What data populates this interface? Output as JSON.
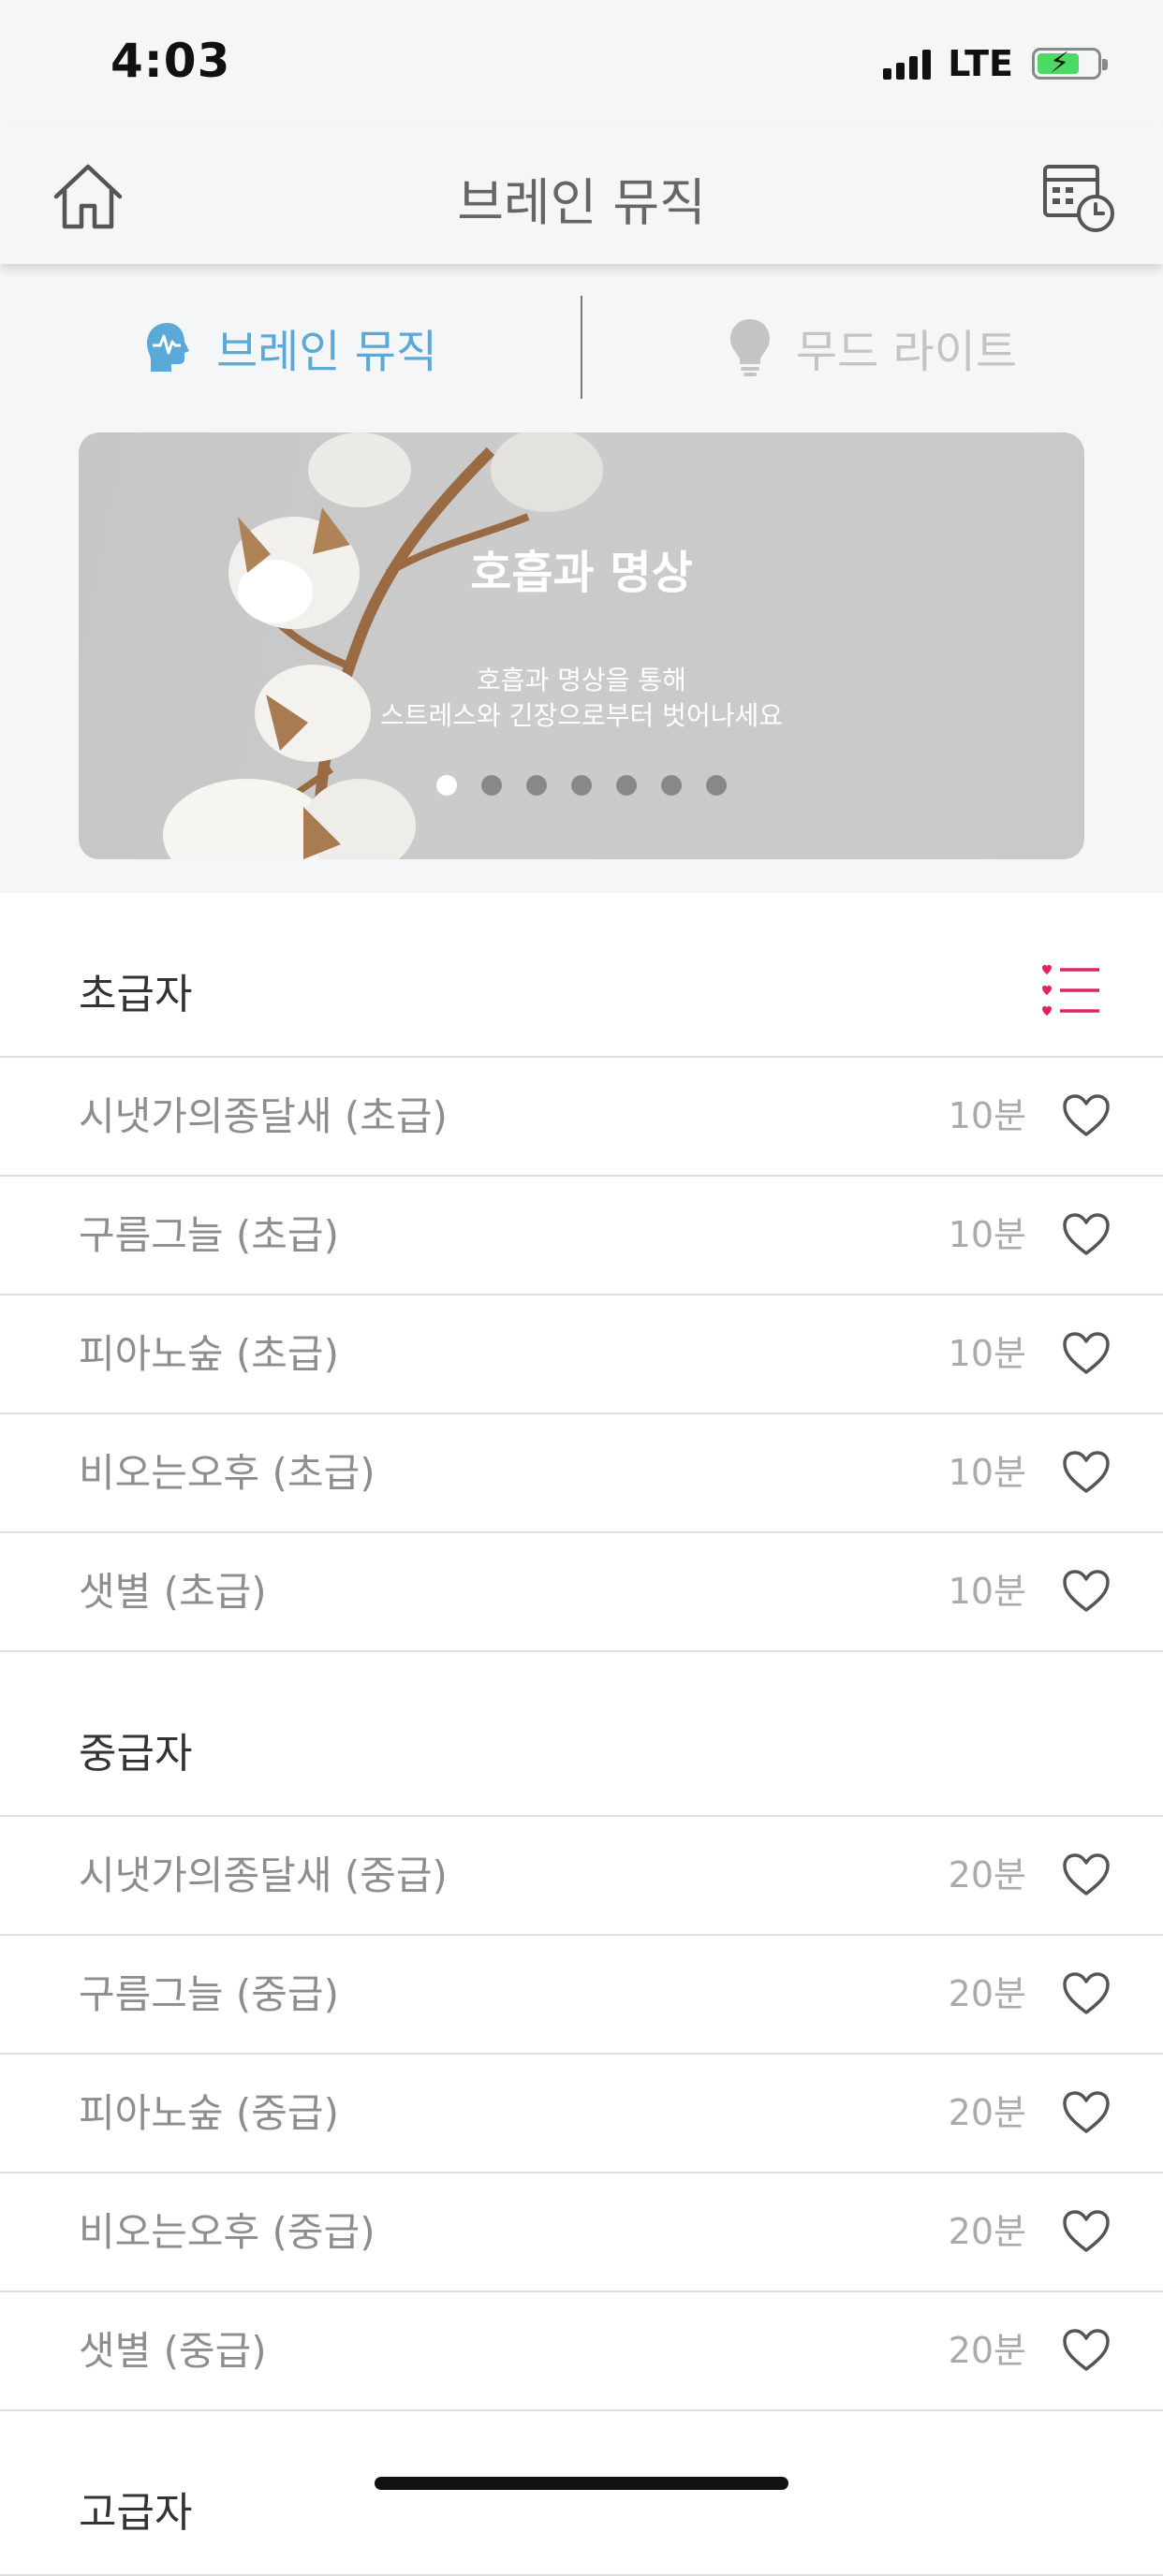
{
  "status_bar": {
    "time": "4:03",
    "network": "LTE",
    "battery_color": "#4cd964"
  },
  "nav": {
    "title": "브레인 뮤직",
    "home_icon": "home-icon",
    "schedule_icon": "calendar-clock-icon"
  },
  "segments": [
    {
      "label": "브레인 뮤직",
      "icon": "brain-icon",
      "active": true,
      "color": "#5aa9d8"
    },
    {
      "label": "무드 라이트",
      "icon": "lightbulb-icon",
      "active": false,
      "color": "#c4c4c4"
    }
  ],
  "banner": {
    "title": "호흡과 명상",
    "subtitle_line1": "호흡과 명상을 통해",
    "subtitle_line2": "스트레스와 긴장으로부터 벗어나세요",
    "page_count": 7,
    "active_page": 1
  },
  "accent_color": "#e0245e",
  "sections": [
    {
      "title": "초급자",
      "items": [
        {
          "title": "시냇가의종달새 (초급)",
          "duration": "10분"
        },
        {
          "title": "구름그늘 (초급)",
          "duration": "10분"
        },
        {
          "title": "피아노숲 (초급)",
          "duration": "10분"
        },
        {
          "title": "비오는오후 (초급)",
          "duration": "10분"
        },
        {
          "title": "샛별 (초급)",
          "duration": "10분"
        }
      ]
    },
    {
      "title": "중급자",
      "items": [
        {
          "title": "시냇가의종달새 (중급)",
          "duration": "20분"
        },
        {
          "title": "구름그늘 (중급)",
          "duration": "20분"
        },
        {
          "title": "피아노숲 (중급)",
          "duration": "20분"
        },
        {
          "title": "비오는오후 (중급)",
          "duration": "20분"
        },
        {
          "title": "샛별 (중급)",
          "duration": "20분"
        }
      ]
    },
    {
      "title": "고급자"
    }
  ]
}
